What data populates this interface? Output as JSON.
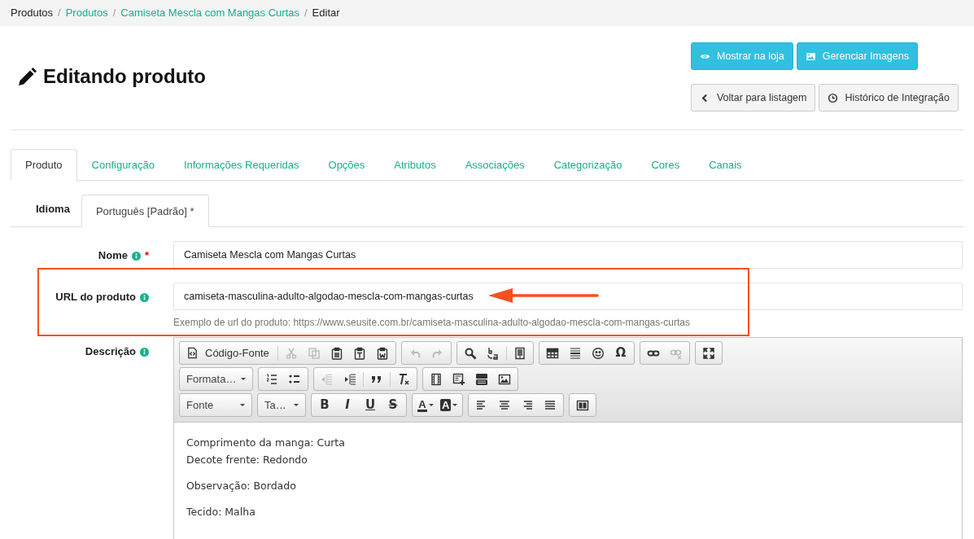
{
  "breadcrumb": {
    "separator": "/",
    "items": [
      {
        "label": "Produtos",
        "link": false
      },
      {
        "label": "Produtos",
        "link": true
      },
      {
        "label": "Camiseta Mescla com Mangas Curtas",
        "link": true
      },
      {
        "label": "Editar",
        "link": false
      }
    ]
  },
  "page_title": "Editando produto",
  "action_rows": [
    [
      {
        "label": "Mostrar na loja",
        "kind": "info"
      },
      {
        "label": "Gerenciar Imagens",
        "kind": "info"
      }
    ],
    [
      {
        "label": "Voltar para listagem",
        "kind": "default"
      },
      {
        "label": "Histórico de Integração",
        "kind": "default"
      }
    ]
  ],
  "tabs": [
    {
      "label": "Produto",
      "selected": true
    },
    {
      "label": "Configuração",
      "selected": false
    },
    {
      "label": "Informações Requeridas",
      "selected": false
    },
    {
      "label": "Opções",
      "selected": false
    },
    {
      "label": "Atributos",
      "selected": false
    },
    {
      "label": "Associações",
      "selected": false
    },
    {
      "label": "Categorização",
      "selected": false
    },
    {
      "label": "Cores",
      "selected": false
    },
    {
      "label": "Canais",
      "selected": false
    }
  ],
  "language": {
    "label": "Idioma",
    "tabs": [
      {
        "label": "Português [Padrão] *",
        "selected": true
      }
    ]
  },
  "fields": [
    {
      "label": "Nome",
      "required_mark": "*",
      "value": "Camiseta Mescla com Mangas Curtas",
      "highlighted": false
    },
    {
      "label": "URL do produto",
      "value": "camiseta-masculina-adulto-algodao-mescla-com-mangas-curtas",
      "help": "Exemplo de url do produto: https://www.seusite.com.br/camiseta-masculina-adulto-algodao-mescla-com-mangas-curtas",
      "highlighted": true
    }
  ],
  "description": {
    "label": "Descrição",
    "toolbar": [
      [
        [
          {
            "kind": "text",
            "label": "Código-Fonte"
          },
          {
            "kind": "separator"
          },
          {
            "kind": "icon",
            "disabled": true
          },
          {
            "kind": "icon",
            "disabled": true
          },
          {
            "kind": "icon",
            "disabled": false
          },
          {
            "kind": "icon",
            "disabled": false
          },
          {
            "kind": "icon",
            "disabled": false
          }
        ],
        [
          {
            "kind": "icon",
            "disabled": true
          },
          {
            "kind": "icon",
            "disabled": true
          }
        ],
        [
          {
            "kind": "icon",
            "disabled": false
          },
          {
            "kind": "icon",
            "disabled": false
          },
          {
            "kind": "separator"
          },
          {
            "kind": "icon",
            "disabled": false
          }
        ],
        [
          {
            "kind": "icon",
            "disabled": false
          },
          {
            "kind": "icon",
            "disabled": false
          },
          {
            "kind": "icon",
            "disabled": false
          },
          {
            "kind": "glyph",
            "label": "Ω",
            "disabled": false
          }
        ],
        [
          {
            "kind": "icon",
            "disabled": false
          },
          {
            "kind": "icon",
            "disabled": true
          }
        ],
        [
          {
            "kind": "icon",
            "disabled": false
          }
        ]
      ],
      [
        [
          {
            "kind": "dropdown",
            "label": "Formata…"
          }
        ],
        [
          {
            "kind": "icon",
            "disabled": false
          },
          {
            "kind": "icon",
            "disabled": false
          }
        ],
        [
          {
            "kind": "icon",
            "disabled": true
          },
          {
            "kind": "icon",
            "disabled": false
          },
          {
            "kind": "separator"
          },
          {
            "kind": "icon",
            "disabled": false
          },
          {
            "kind": "separator"
          },
          {
            "kind": "icon",
            "disabled": false
          }
        ],
        [
          {
            "kind": "icon",
            "disabled": false
          },
          {
            "kind": "icon",
            "disabled": false
          },
          {
            "kind": "icon",
            "disabled": false
          },
          {
            "kind": "icon",
            "disabled": false
          }
        ]
      ],
      [
        [
          {
            "kind": "dropdown",
            "label": "Fonte"
          }
        ],
        [
          {
            "kind": "dropdown",
            "label": "Ta…"
          }
        ],
        [
          {
            "kind": "glyph",
            "label": "B",
            "disabled": false
          },
          {
            "kind": "glyph",
            "label": "I",
            "disabled": false
          },
          {
            "kind": "glyph",
            "label": "U",
            "disabled": false
          },
          {
            "kind": "glyph",
            "label": "S",
            "disabled": false
          }
        ],
        [
          {
            "kind": "color",
            "label": "A"
          },
          {
            "kind": "color",
            "label": "A"
          }
        ],
        [
          {
            "kind": "icon",
            "disabled": false
          },
          {
            "kind": "icon",
            "disabled": false
          },
          {
            "kind": "icon",
            "disabled": false
          },
          {
            "kind": "icon",
            "disabled": false
          }
        ],
        [
          {
            "kind": "icon",
            "disabled": false
          }
        ]
      ]
    ],
    "content": [
      [
        "Comprimento da manga: Curta",
        "Decote frente: Redondo"
      ],
      [
        "Observação: Bordado"
      ],
      [
        "Tecido: Malha"
      ]
    ]
  }
}
